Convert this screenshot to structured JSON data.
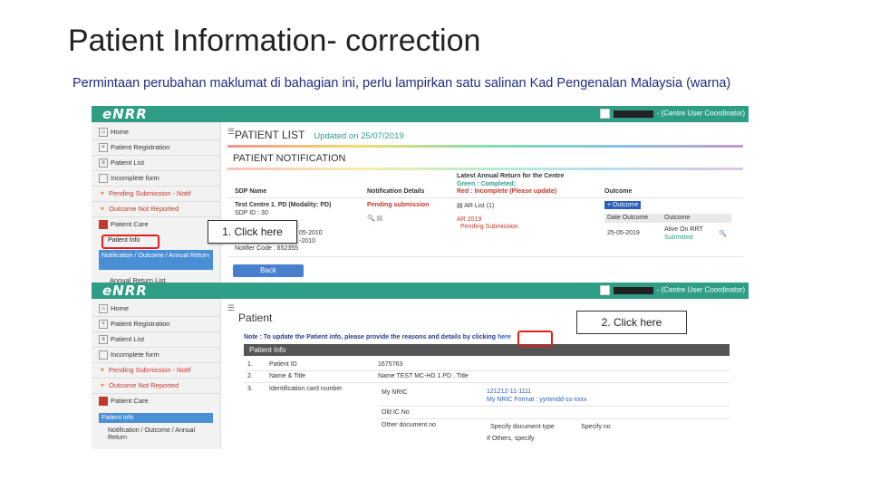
{
  "slide": {
    "title": "Patient Information- correction",
    "subtitle": "Permintaan perubahan maklumat di bahagian ini, perlu lampirkan satu salinan Kad Pengenalan Malaysia (warna)"
  },
  "app": {
    "logo": "eNRR",
    "user_role": "- (Centre User Coordinator)"
  },
  "sidebar": {
    "items": [
      "Home",
      "Patient Registration",
      "Patient List",
      "Incomplete form",
      "Pending Submission - Notif",
      "Outcome Not Reported",
      "Patient Care"
    ],
    "sub_patient_info": "Patient Info",
    "sub_notification": "Notification / Outcome / Annual Return",
    "annual_return": "Annual Return List"
  },
  "screen1": {
    "patient_list_title": "PATIENT LIST",
    "updated_on": "Updated on 25/07/2019",
    "notification_title": "PATIENT NOTIFICATION",
    "lar_title": "Latest Annual Return for the Centre",
    "legend_green": "Green : Completed;",
    "legend_red": "Red : Incomplete (Please update)",
    "col_sdp": "SDP Name",
    "col_notification": "Notification Details",
    "col_outcome": "Outcome",
    "sdp_name": "Test Centre 1. PD (Modality: PD)",
    "sdp_no": "SDP ID : 30",
    "notif_status": "Pending submission",
    "ar_list": "AR List (1)",
    "ar_year": "AR 2019",
    "ar_pending": "Pending Submission",
    "outcome_btn": "Outcome",
    "date_outcome_h": "Date Outcome",
    "outcome_h": "Outcome",
    "outcome_date": "25-05-2019",
    "outcome_val": "Alive On RRT",
    "outcome_status": "Submitted",
    "date_notif": "05-2010",
    "date_notif2": "-2010",
    "notifier_code": "Notifier Code : 652355",
    "back_btn": "Back"
  },
  "screen2": {
    "patient_title": "Patient",
    "note_text": "Note : To update the Patient info, please provide the reasons and details by clicking",
    "note_link": "here",
    "panel_title": "Patient Info",
    "rows": [
      {
        "no": "1.",
        "label": "Patient ID",
        "value": "1675763"
      },
      {
        "no": "2.",
        "label": "Name & Title",
        "value": "Name TEST MC-HD 1.PD , Title"
      },
      {
        "no": "3.",
        "label": "Identification card number",
        "value": ""
      }
    ],
    "my_nric_label": "My NRIC",
    "my_nric_value": "121212-11-1111",
    "my_nric_format": "My NRIC Format : yymmdd-ss-xxxx",
    "old_ic_label": "Old IC No",
    "other_doc_label": "Other document no",
    "specify_doc": "Specify document type",
    "specify_no": "Specify no",
    "if_others": "If Others, specify"
  },
  "callouts": {
    "step1": "1. Click here",
    "step2": "2. Click here"
  }
}
